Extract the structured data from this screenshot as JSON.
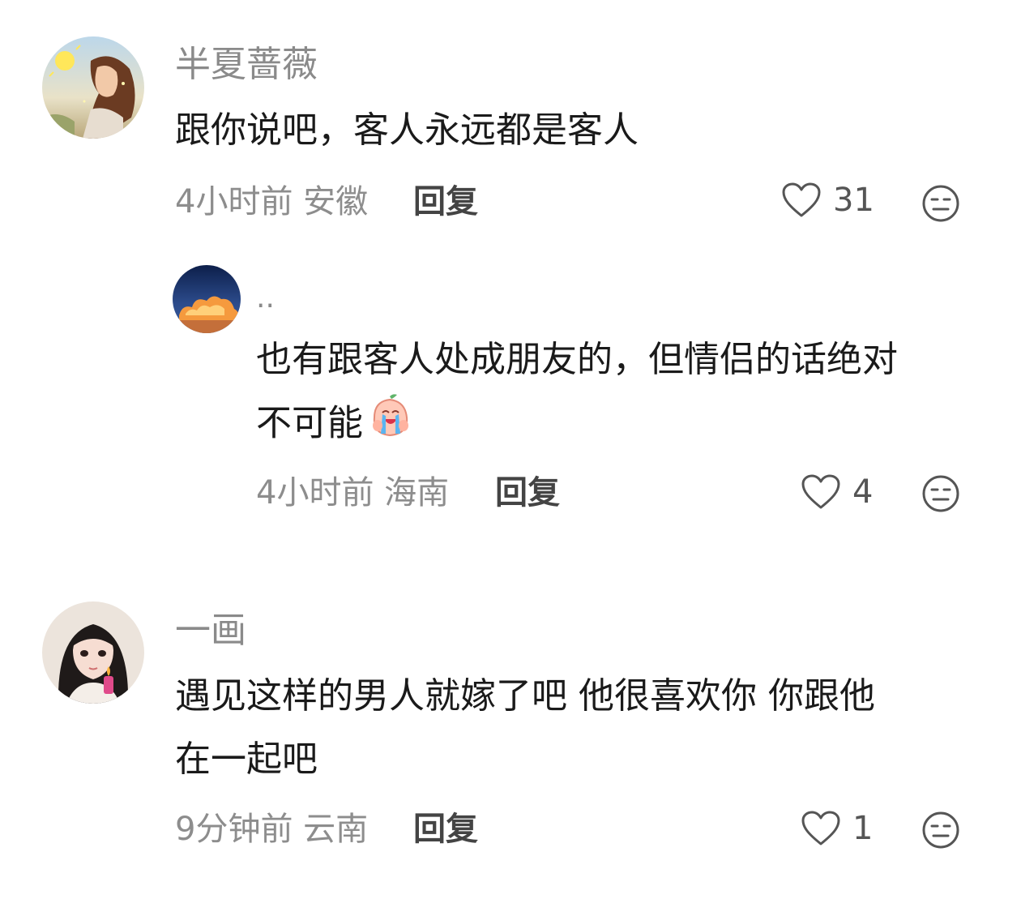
{
  "comments": [
    {
      "username": "半夏蔷薇",
      "text": "跟你说吧，客人永远都是客人",
      "time_location": "4小时前 安徽",
      "reply_label": "回复",
      "likes": "31",
      "avatar_icon": "girl-with-sun-avatar",
      "replies": [
        {
          "username": "..",
          "text_line1": "也有跟客人处成朋友的，但情侣的话绝对",
          "text_line2": "不可能",
          "emoji_icon": "crying-peach-emoji",
          "time_location": "4小时前 海南",
          "reply_label": "回复",
          "likes": "4",
          "avatar_icon": "sunset-cloud-avatar"
        }
      ]
    },
    {
      "username": "一画",
      "text_line1": "遇见这样的男人就嫁了吧 他很喜欢你 你跟他",
      "text_line2": "在一起吧",
      "time_location": "9分钟前 云南",
      "reply_label": "回复",
      "likes": "1",
      "avatar_icon": "girl-with-lighter-avatar"
    }
  ],
  "colors": {
    "username": "#8a8a8a",
    "text": "#1a1a1a",
    "meta": "#8d8d8d",
    "reply": "#444444",
    "icon": "#555555"
  }
}
